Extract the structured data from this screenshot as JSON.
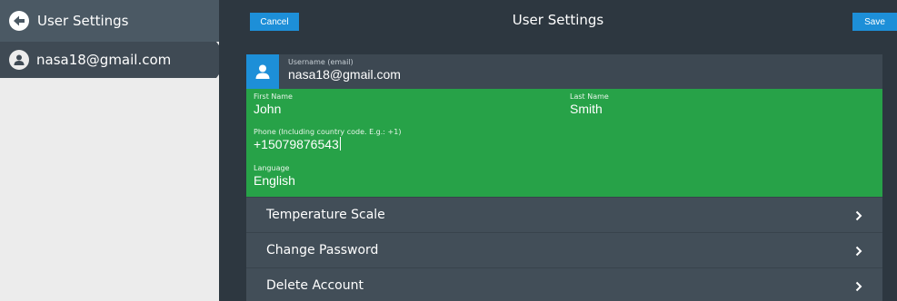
{
  "sidebar": {
    "header_title": "User Settings",
    "account_email": "nasa18@gmail.com"
  },
  "topbar": {
    "cancel_label": "Cancel",
    "title": "User Settings",
    "save_label": "Save"
  },
  "user": {
    "username_label": "Username (email)",
    "username_value": "nasa18@gmail.com"
  },
  "form": {
    "first_name_label": "First Name",
    "first_name_value": "John",
    "last_name_label": "Last Name",
    "last_name_value": "Smith",
    "phone_label": "Phone (Including country code. E.g.: +1)",
    "phone_value": "+15079876543",
    "language_label": "Language",
    "language_value": "English"
  },
  "menu_items": [
    {
      "label": "Temperature Scale",
      "icon": "chevron-right-icon"
    },
    {
      "label": "Change Password",
      "icon": "chevron-right-icon"
    },
    {
      "label": "Delete Account",
      "icon": "chevron-right-icon"
    }
  ],
  "colors": {
    "accent": "#1d8fd8",
    "form_background": "#27a248",
    "panel_background": "#2d3740",
    "sidebar_selected": "#3f4a54"
  }
}
